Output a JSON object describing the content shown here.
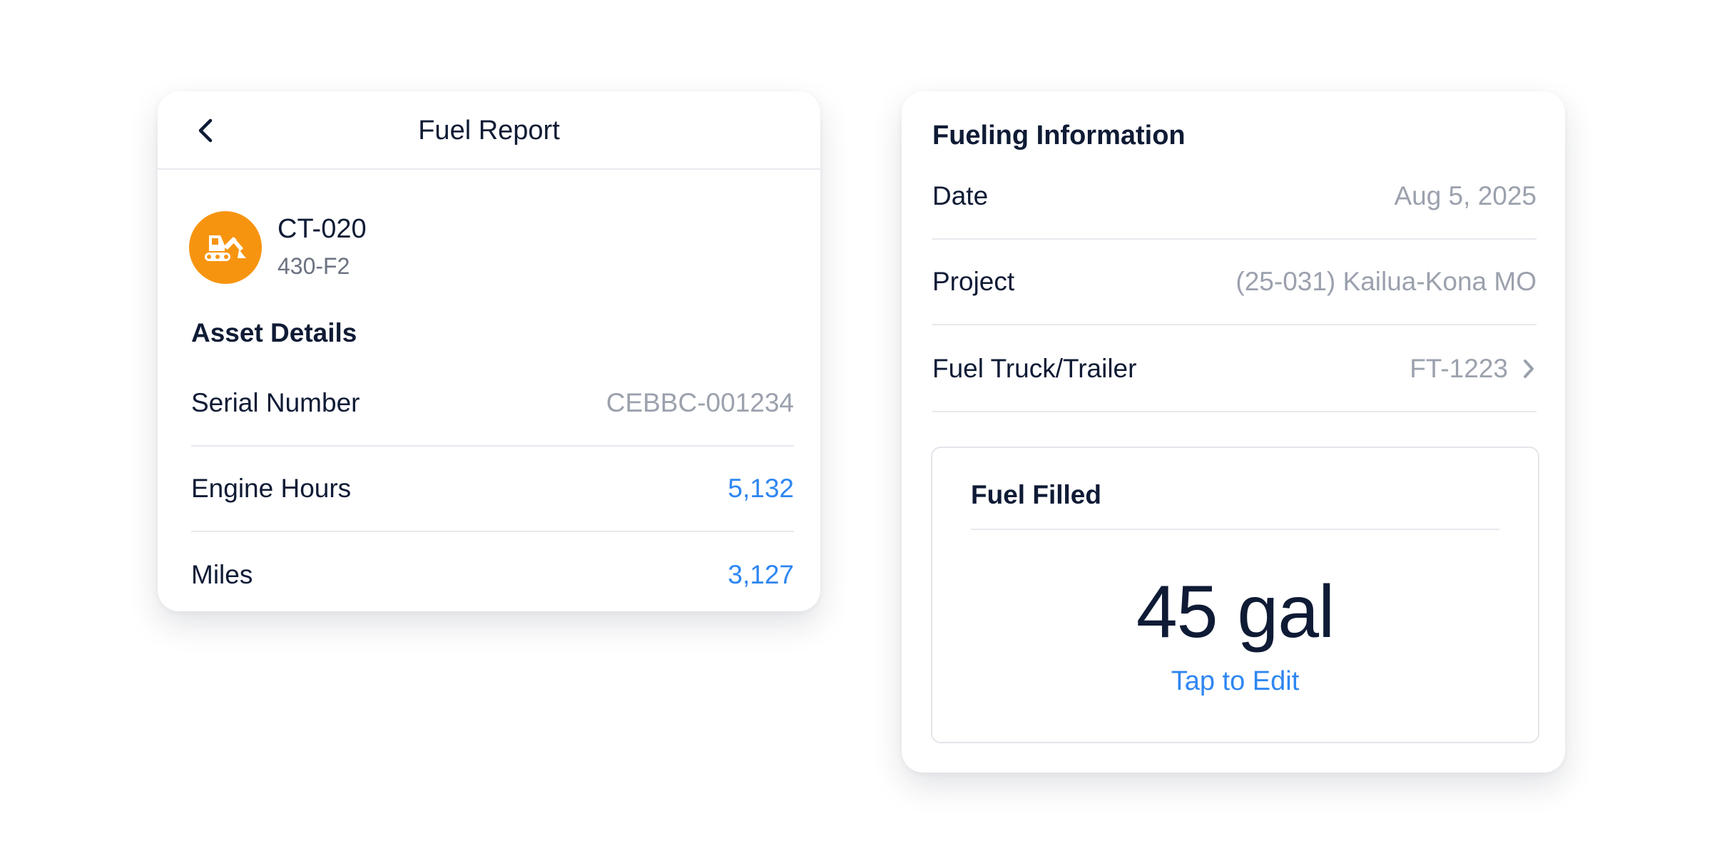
{
  "header": {
    "title": "Fuel Report",
    "back_icon": "chevron-left-icon"
  },
  "asset": {
    "icon": "excavator-icon",
    "icon_color": "#f7940f",
    "name": "CT-020",
    "model": "430-F2"
  },
  "asset_details": {
    "title": "Asset Details",
    "rows": [
      {
        "label": "Serial Number",
        "value": "CEBBC-001234"
      },
      {
        "label": "Engine Hours",
        "value": "5,132"
      },
      {
        "label": "Miles",
        "value": "3,127"
      }
    ]
  },
  "fueling_info": {
    "title": "Fueling Information",
    "rows": [
      {
        "label": "Date",
        "value": "Aug 5, 2025"
      },
      {
        "label": "Project",
        "value": "(25-031) Kailua-Kona MO"
      },
      {
        "label": "Fuel Truck/Trailer",
        "value": "FT-1223",
        "icon": "chevron-right-icon"
      }
    ]
  },
  "fuel_filled": {
    "title": "Fuel Filled",
    "amount": "45 gal",
    "edit_label": "Tap to Edit"
  },
  "colors": {
    "accent": "#2e86f2",
    "text": "#0f1b35",
    "muted": "#9ba1ad",
    "asset_badge": "#f7940f"
  }
}
